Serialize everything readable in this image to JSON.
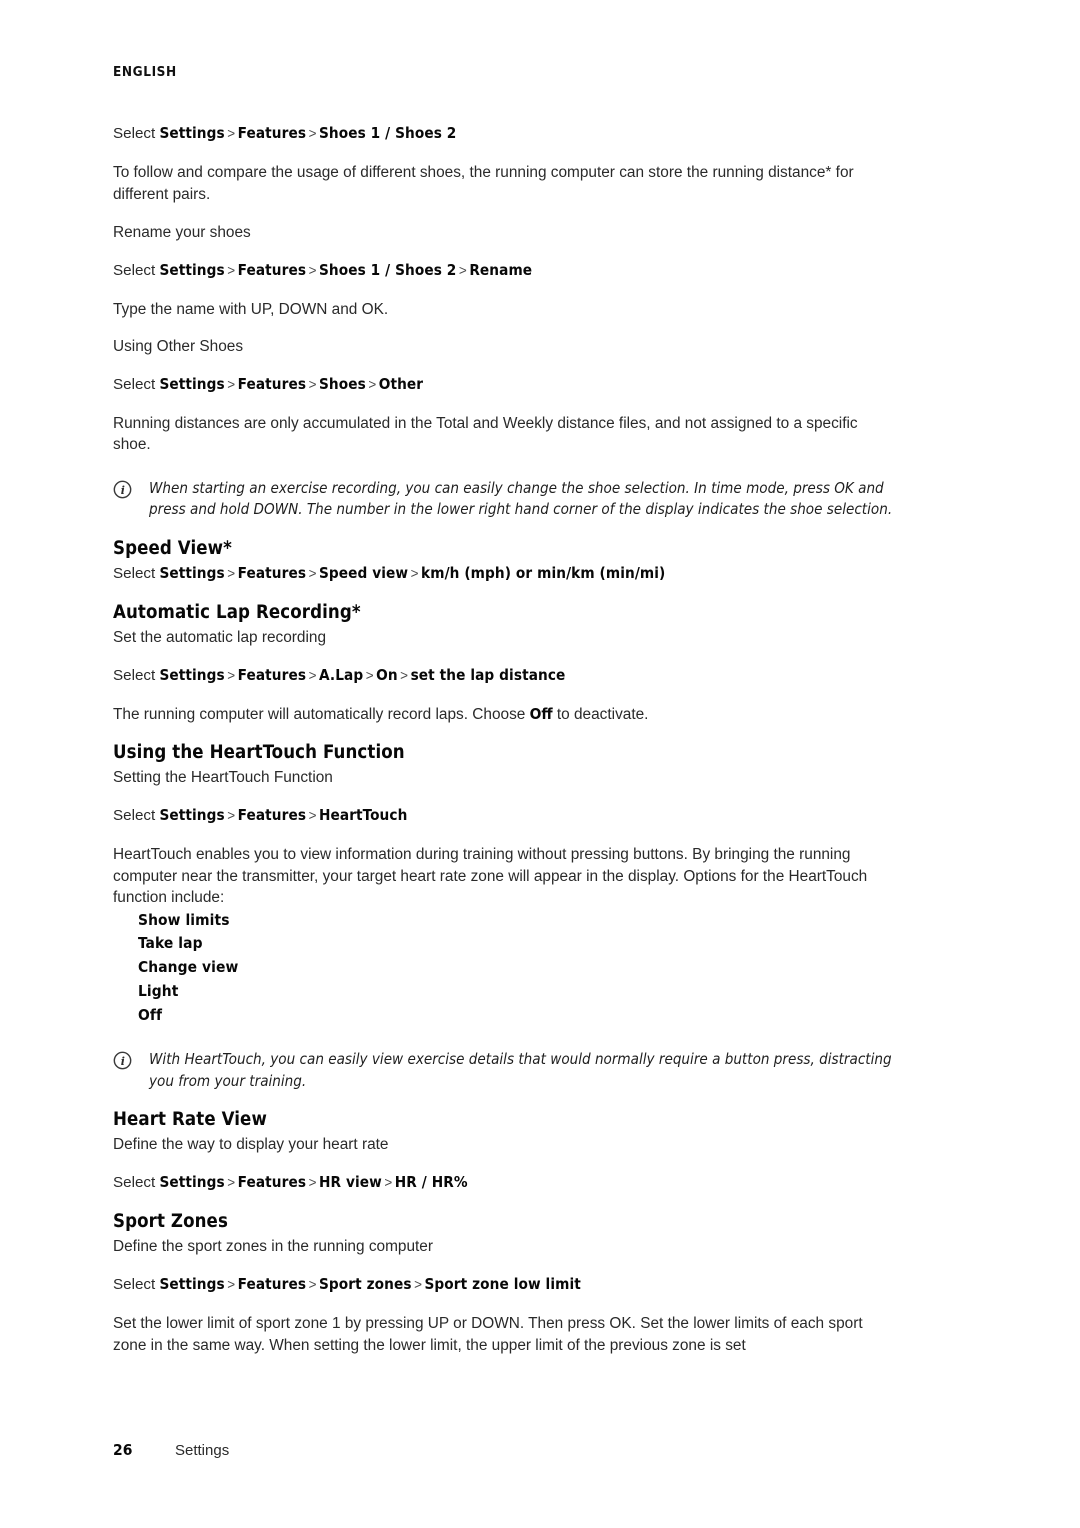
{
  "page": {
    "running_head": "ENGLISH",
    "footer": {
      "page_number": "26",
      "section": "Settings"
    }
  },
  "icons": {
    "info": "info-circle-icon"
  },
  "labels": {
    "select": "Select",
    "separator": ">"
  },
  "sections": [
    {
      "id": "shoes",
      "crumb1": {
        "lead": "Select",
        "nodes": [
          "Settings",
          "Features",
          "Shoes 1 / Shoes 2"
        ]
      },
      "para1": "To follow and compare the usage of different shoes, the running computer can store the running distance* for different pairs.",
      "subhead1": "Rename your shoes",
      "crumb2": {
        "lead": "Select",
        "nodes": [
          "Settings",
          "Features",
          "Shoes 1 / Shoes 2",
          "Rename"
        ]
      },
      "para2": "Type the name with  UP, DOWN and OK.",
      "subhead2": "Using Other Shoes",
      "crumb3": {
        "lead": "Select",
        "nodes": [
          "Settings",
          "Features",
          "Shoes",
          "Other"
        ]
      },
      "para3": "Running distances are only accumulated in the Total and Weekly distance files, and not assigned to a specific shoe.",
      "note": "When starting an exercise recording, you can easily change the shoe selection. In time mode, press OK and press and hold DOWN. The number in the lower right hand corner of the display indicates the shoe selection."
    },
    {
      "id": "speed-view",
      "heading": "Speed View*",
      "crumb": {
        "lead": "Select",
        "nodes": [
          "Settings",
          "Features",
          "Speed view",
          "km/h (mph) or min/km (min/mi)"
        ]
      }
    },
    {
      "id": "automatic-lap-recording",
      "heading": "Automatic Lap Recording*",
      "subline": "Set the automatic lap recording",
      "crumb": {
        "lead": "Select",
        "nodes": [
          "Settings",
          "Features",
          "A.Lap",
          "On",
          "set the lap distance"
        ]
      },
      "para_before": "The running computer will automatically record laps. Choose ",
      "para_token": "Off",
      "para_after": " to deactivate."
    },
    {
      "id": "heart-touch",
      "heading": "Using the HeartTouch Function",
      "subline": "Setting the HeartTouch Function",
      "crumb": {
        "lead": "Select",
        "nodes": [
          "Settings",
          "Features",
          "HeartTouch"
        ]
      },
      "para": "HeartTouch enables you to view information during training without pressing buttons. By bringing the running computer near the transmitter, your target heart rate zone will appear in the display. Options for the HeartTouch function include:",
      "options": [
        "Show limits",
        "Take lap",
        "Change view",
        "Light",
        "Off"
      ],
      "note": "With HeartTouch, you can easily view exercise details that would normally require a button press, distracting you from your training."
    },
    {
      "id": "heart-rate-view",
      "heading": "Heart Rate View",
      "subline": "Define the way to display your heart rate",
      "crumb": {
        "lead": "Select",
        "nodes": [
          "Settings",
          "Features",
          "HR view",
          "HR / HR%"
        ]
      }
    },
    {
      "id": "sport-zones",
      "heading": "Sport Zones",
      "subline": "Define the sport zones in the running computer",
      "crumb": {
        "lead": "Select",
        "nodes": [
          "Settings",
          "Features",
          "Sport zones",
          "Sport zone low limit"
        ]
      },
      "para": "Set the lower limit of sport zone 1 by pressing UP or DOWN. Then press OK. Set the lower limits of each sport zone in the same way. When setting the lower limit, the upper limit of the previous zone is set"
    }
  ]
}
